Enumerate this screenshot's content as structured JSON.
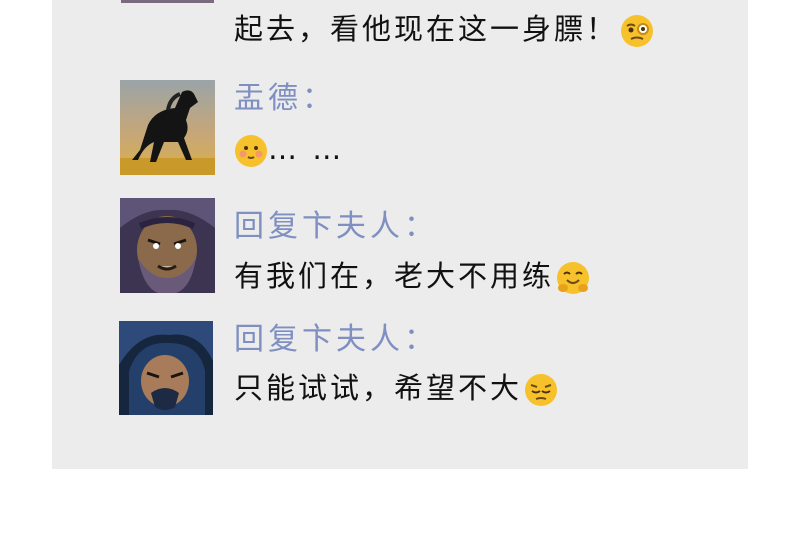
{
  "messages": [
    {
      "sender": "",
      "text": "起去，看他现在这一身膘！",
      "emoji": "face-with-monocle-emoji",
      "colors": {
        "emoji": "#f7c12b"
      }
    },
    {
      "sender": "盂德：",
      "text": "… …",
      "emoji": "smiling-face-emoji",
      "avatar": "black-horse-avatar",
      "colors": {
        "emoji": "#f7c12b"
      }
    },
    {
      "sender": "回复卞夫人：",
      "text": "有我们在，老大不用练",
      "emoji": "hugging-face-emoji",
      "avatar": "bearded-warrior-avatar",
      "colors": {
        "emoji": "#f7c12b"
      }
    },
    {
      "sender": "回复卞夫人：",
      "text": "只能试试，希望不大",
      "emoji": "pensive-face-emoji",
      "avatar": "blue-haired-warrior-avatar",
      "colors": {
        "emoji": "#f7c12b"
      }
    }
  ],
  "colors": {
    "panel_bg": "#ececec",
    "name": "#7f8fc1",
    "text": "#111111"
  }
}
